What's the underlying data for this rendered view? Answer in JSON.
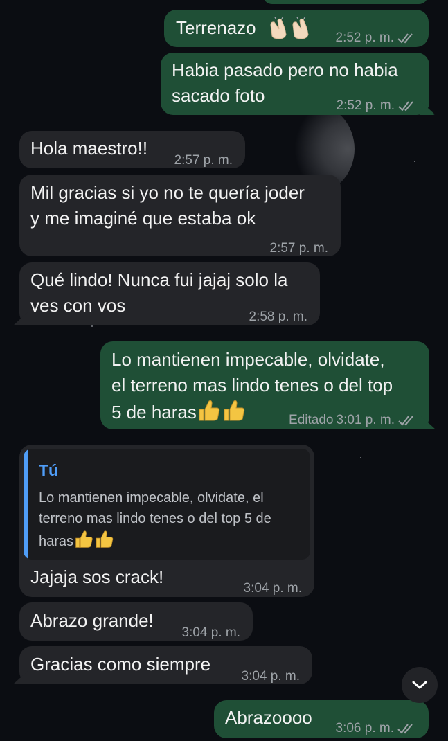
{
  "messages": [
    {
      "id": "m1",
      "dir": "out",
      "text": "Terrenazo",
      "emoji": "clapping-hands",
      "time": "2:52 p. m."
    },
    {
      "id": "m2",
      "dir": "out",
      "lines": [
        "Habia pasado pero no habia",
        "sacado foto"
      ],
      "time": "2:52 p. m."
    },
    {
      "id": "m3",
      "dir": "in",
      "text": "Hola maestro!!",
      "time": "2:57 p. m."
    },
    {
      "id": "m4",
      "dir": "in",
      "lines": [
        "Mil gracias si yo no te quería joder",
        "y me imaginé que estaba ok"
      ],
      "time": "2:57 p. m."
    },
    {
      "id": "m5",
      "dir": "in",
      "lines": [
        "Qué lindo! Nunca fui jajaj solo la",
        "ves con vos"
      ],
      "time": "2:58 p. m."
    },
    {
      "id": "m6",
      "dir": "out",
      "lines": [
        "Lo mantienen impecable, olvidate,",
        "el terreno mas lindo tenes o del top",
        "5 de haras"
      ],
      "emoji": "thumbs-up",
      "edited": "Editado",
      "time": "3:01 p. m."
    },
    {
      "id": "m7",
      "dir": "in",
      "reply_author": "Tú",
      "reply_lines": [
        "Lo mantienen impecable, olvidate, el",
        "terreno mas lindo tenes o del top 5 de",
        "haras"
      ],
      "text": "Jajaja sos crack!",
      "time": "3:04 p. m."
    },
    {
      "id": "m8",
      "dir": "in",
      "text": "Abrazo grande!",
      "time": "3:04 p. m."
    },
    {
      "id": "m9",
      "dir": "in",
      "text": "Gracias como siempre",
      "time": "3:04 p. m."
    },
    {
      "id": "m10",
      "dir": "out",
      "text": "Abrazoooo",
      "time": "3:06 p. m."
    }
  ],
  "colors": {
    "outgoing": "#1f4f36",
    "incoming": "#242529",
    "accent": "#4f9df7",
    "meta": "#9ea3a8",
    "background": "#0b0d12"
  },
  "icons": {
    "read_receipt": "double-check-icon",
    "scroll": "chevron-down-icon"
  }
}
